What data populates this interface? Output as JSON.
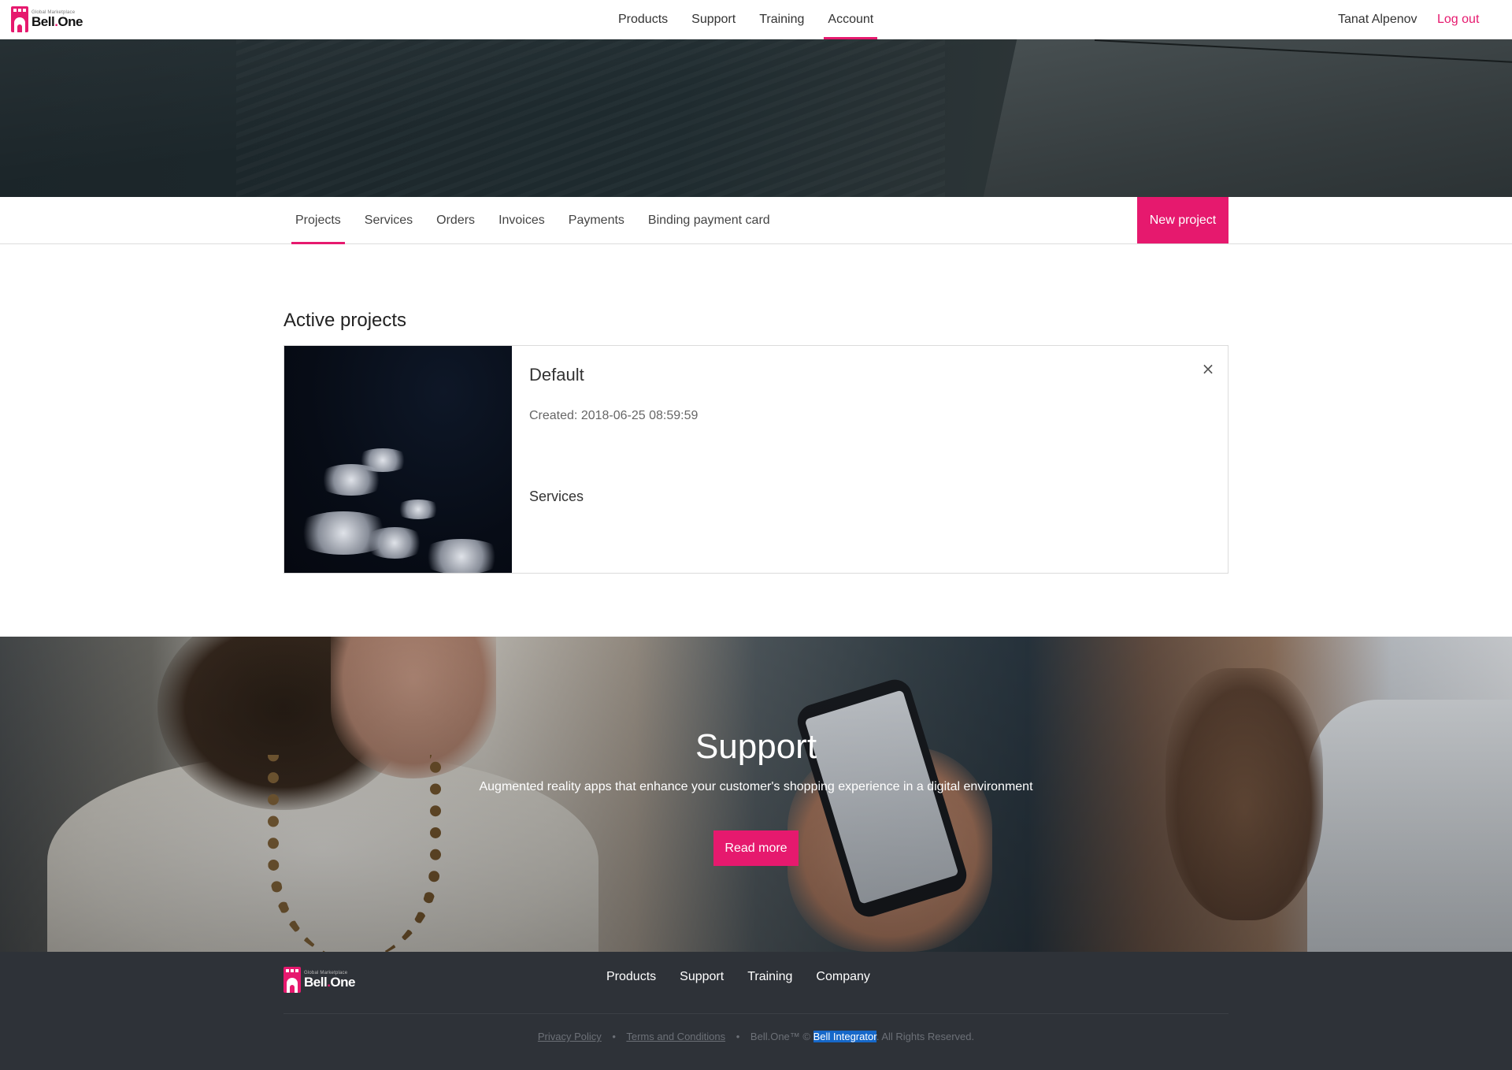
{
  "brand": {
    "tagline": "Global Marketplace",
    "name_main": "Bell",
    "name_dot": ".",
    "name_suffix": "One",
    "accent_color": "#e6196e"
  },
  "topnav": {
    "items": [
      {
        "label": "Products"
      },
      {
        "label": "Support"
      },
      {
        "label": "Training"
      },
      {
        "label": "Account",
        "active": true
      }
    ],
    "user_name": "Tanat Alpenov",
    "logout_label": "Log out"
  },
  "subtabs": {
    "items": [
      {
        "label": "Projects",
        "active": true
      },
      {
        "label": "Services"
      },
      {
        "label": "Orders"
      },
      {
        "label": "Invoices"
      },
      {
        "label": "Payments"
      },
      {
        "label": "Binding payment card"
      }
    ],
    "new_project_label": "New project"
  },
  "projects": {
    "section_title": "Active projects",
    "items": [
      {
        "title": "Default",
        "created": "Created: 2018-06-25 08:59:59",
        "services_label": "Services",
        "close_icon": "×"
      }
    ]
  },
  "support_banner": {
    "title": "Support",
    "subtitle": "Augmented reality apps that enhance your customer's shopping experience in a digital environment",
    "button_label": "Read more"
  },
  "footer": {
    "nav": [
      {
        "label": "Products"
      },
      {
        "label": "Support"
      },
      {
        "label": "Training"
      },
      {
        "label": "Company"
      }
    ],
    "legal": {
      "privacy": "Privacy Policy",
      "terms": "Terms and Conditions",
      "separator": "•",
      "copyright_prefix": "Bell.One™ ©",
      "company": "Bell Integrator",
      "rights": ". All Rights Reserved."
    }
  }
}
